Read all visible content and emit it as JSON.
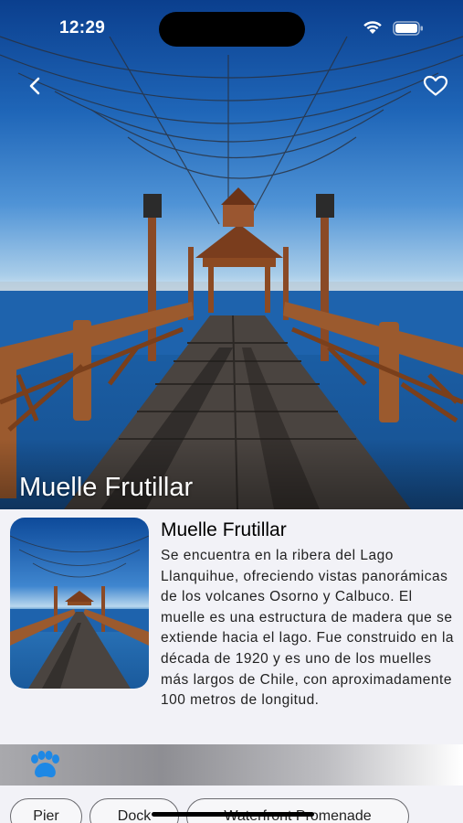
{
  "status_bar": {
    "time": "12:29"
  },
  "place": {
    "title": "Muelle Frutillar",
    "description": "Se encuentra en la ribera del Lago Llanquihue, ofreciendo vistas panorámicas de los volcanes Osorno y Calbuco. El muelle es una estructura de madera que se extiende hacia el lago. Fue construido en la década de 1920 y es uno de los muelles más largos de Chile, con aproximadamente 100 metros de longitud."
  },
  "navigation": {
    "back_icon": "chevron-left-icon",
    "favorite_icon": "heart-icon"
  },
  "category": {
    "icon": "paw-icon",
    "color": "#1e88e5"
  },
  "tags": [
    {
      "label": "Pier"
    },
    {
      "label": "Dock"
    },
    {
      "label": "Waterfront Promenade"
    }
  ]
}
